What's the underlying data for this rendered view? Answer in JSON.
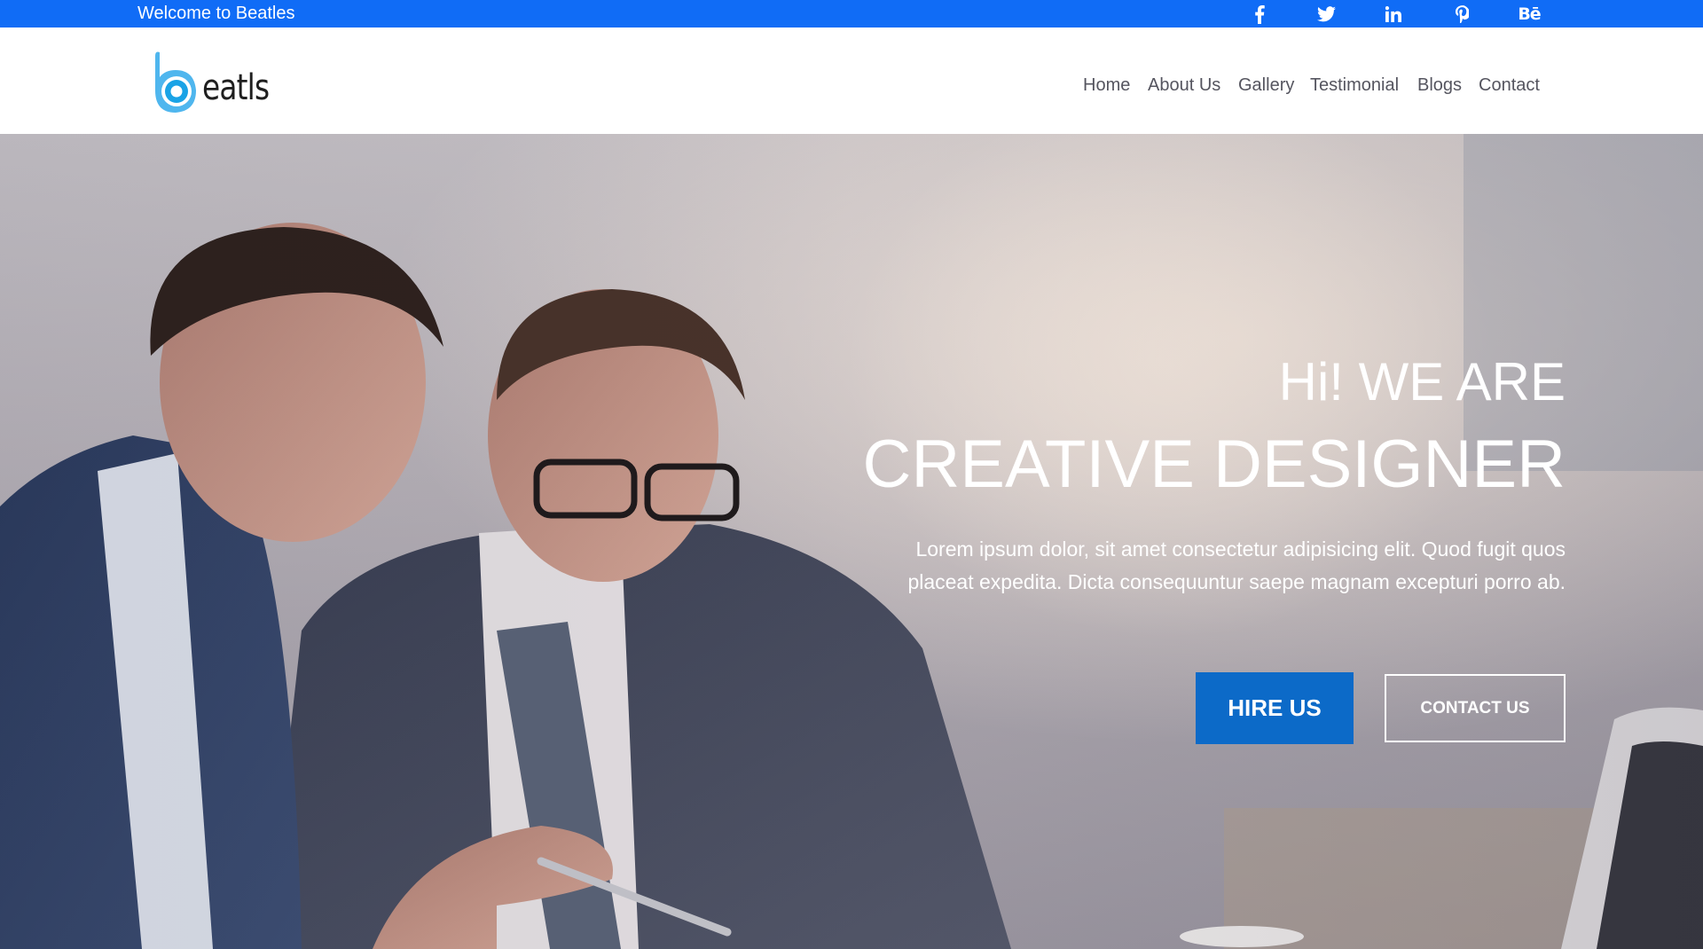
{
  "topbar": {
    "welcome": "Welcome to Beatles",
    "background": "#106cf6",
    "socials": [
      {
        "icon": "facebook-icon"
      },
      {
        "icon": "twitter-icon"
      },
      {
        "icon": "linkedin-icon"
      },
      {
        "icon": "pinterest-icon"
      },
      {
        "icon": "behance-icon",
        "glyph": "Bē"
      }
    ]
  },
  "header": {
    "logo_text": "eatls",
    "logo_color": "#1aa3e6",
    "nav": [
      "Home",
      "About Us",
      "Gallery",
      "Testimonial",
      "Blogs",
      "Contact"
    ]
  },
  "hero": {
    "line1": "Hi! WE ARE",
    "line2": "CREATIVE DESIGNER",
    "description": "Lorem ipsum dolor, sit amet consectetur adipisicing elit. Quod fugit quos placeat expedita. Dicta consequuntur saepe magnam excepturi porro ab.",
    "hire_button": "HIRE US",
    "contact_button": "CONTACT US",
    "accent": "#0c6ac8"
  }
}
